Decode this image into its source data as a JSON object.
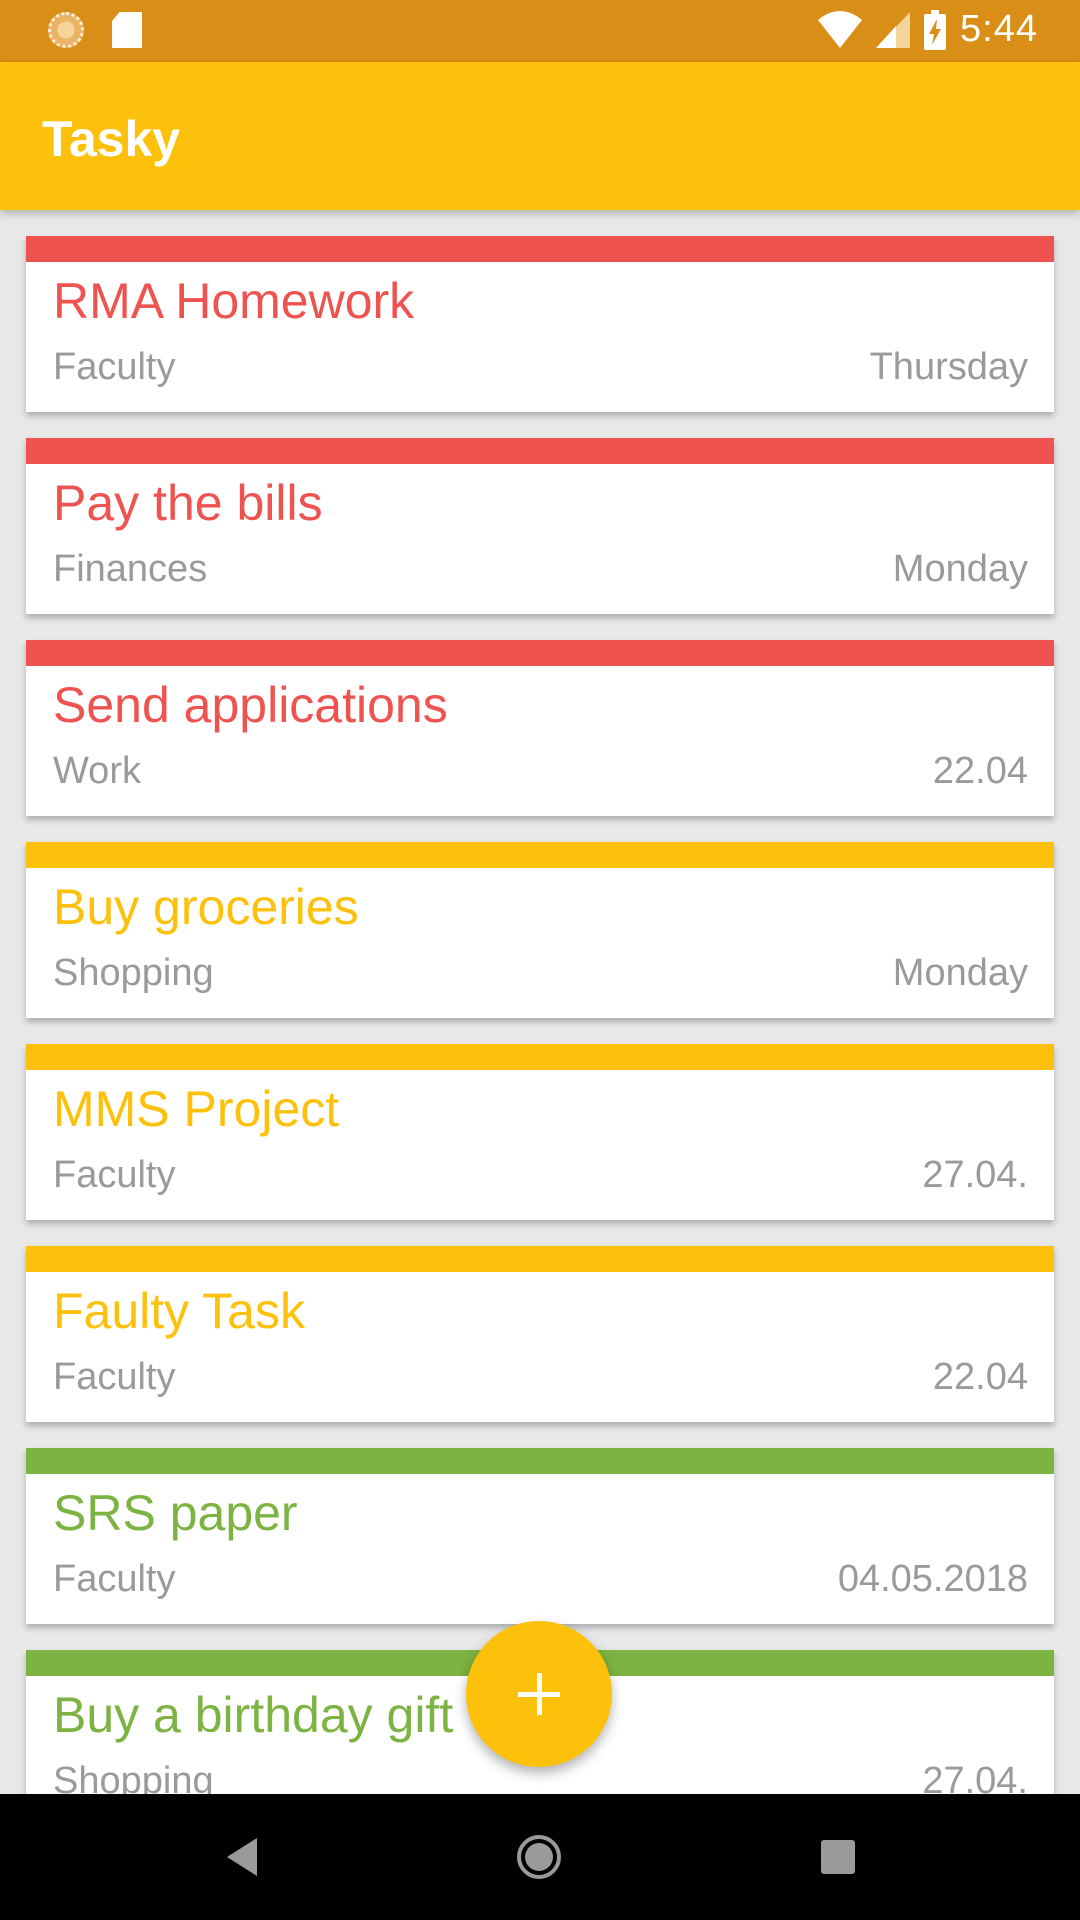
{
  "status_bar": {
    "time": "5:44",
    "left_icons": [
      "notification-icon",
      "sd-card-icon"
    ],
    "right_icons": [
      "wifi-icon",
      "signal-icon",
      "battery-charging-icon"
    ]
  },
  "app_bar": {
    "title": "Tasky"
  },
  "colors": {
    "high_priority": "#ef5350",
    "medium_priority": "#fdc10b",
    "low_priority": "#7cb342",
    "app_bar": "#fdc10b",
    "status_bar": "#d98e18"
  },
  "tasks": [
    {
      "title": "RMA Homework",
      "category": "Faculty",
      "date": "Thursday",
      "priority": "high"
    },
    {
      "title": "Pay the bills",
      "category": "Finances",
      "date": "Monday",
      "priority": "high"
    },
    {
      "title": "Send applications",
      "category": "Work",
      "date": "22.04",
      "priority": "high"
    },
    {
      "title": "Buy groceries",
      "category": "Shopping",
      "date": "Monday",
      "priority": "medium"
    },
    {
      "title": "MMS Project",
      "category": "Faculty",
      "date": "27.04.",
      "priority": "medium"
    },
    {
      "title": "Faulty Task",
      "category": "Faculty",
      "date": "22.04",
      "priority": "medium"
    },
    {
      "title": "SRS paper",
      "category": "Faculty",
      "date": "04.05.2018",
      "priority": "low"
    },
    {
      "title": "Buy a birthday gift",
      "category": "Shopping",
      "date": "27.04.",
      "priority": "low"
    }
  ],
  "fab": {
    "icon": "plus-icon"
  },
  "nav_bar": {
    "icons": [
      "back-icon",
      "home-icon",
      "recents-icon"
    ]
  }
}
